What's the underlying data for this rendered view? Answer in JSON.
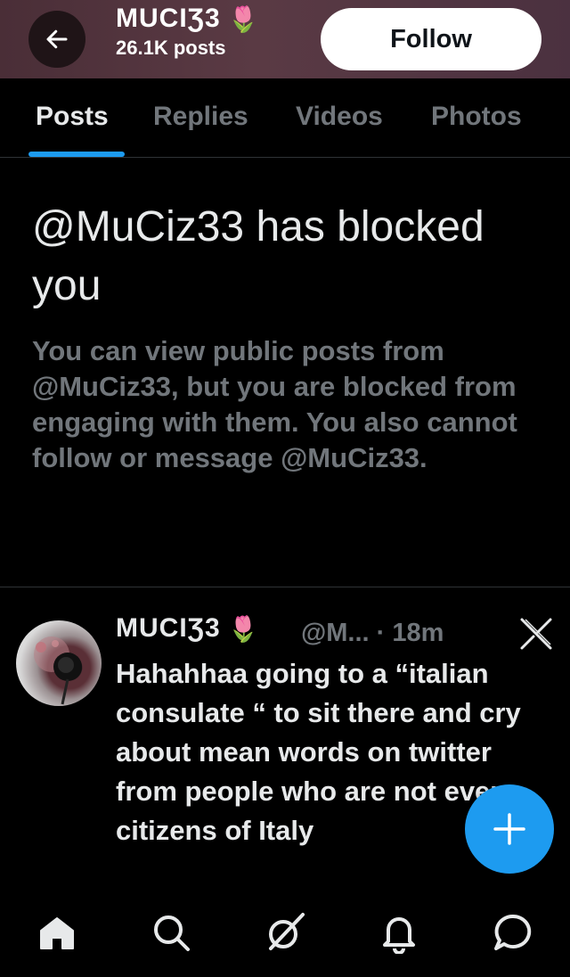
{
  "header": {
    "profile_name": "MUCIƷ3",
    "profile_emoji": "🌷",
    "post_count": "26.1K posts",
    "follow_label": "Follow"
  },
  "tabs": [
    {
      "label": "Posts",
      "active": true
    },
    {
      "label": "Replies",
      "active": false
    },
    {
      "label": "Videos",
      "active": false
    },
    {
      "label": "Photos",
      "active": false
    }
  ],
  "blocked": {
    "title": "@MuCiz33 has blocked you",
    "description": "You can view public posts from @MuCiz33, but you are blocked from engaging with them. You also cannot follow or message @MuCiz33."
  },
  "post": {
    "author_name": "MUCIƷ3",
    "author_emoji": "🌷",
    "handle_time": "@M... · 18m",
    "text": "Hahahhaa going to a “italian consulate “ to sit there and cry about mean words on twitter from people who are not even citizens of Italy"
  },
  "colors": {
    "accent": "#1d9bf0",
    "muted_text": "#71767b",
    "header_bg": "#5a3a44"
  },
  "icons": {
    "back": "arrow-left-icon",
    "grok": "grok-icon",
    "compose": "plus-icon",
    "nav": [
      "home-icon",
      "search-icon",
      "grok-nav-icon",
      "notifications-icon",
      "messages-icon"
    ]
  }
}
